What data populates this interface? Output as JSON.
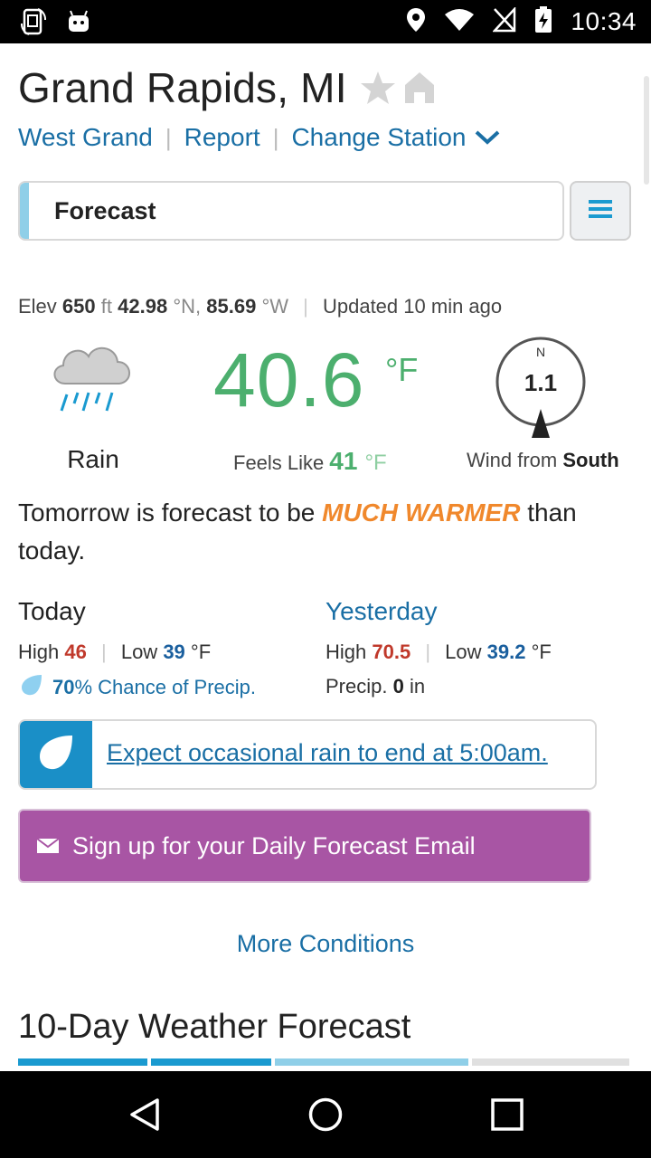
{
  "status_bar": {
    "time": "10:34",
    "icons": [
      "screen-rotate-icon",
      "android-icon",
      "location-icon",
      "wifi-icon",
      "no-sim-icon",
      "battery-charging-icon"
    ]
  },
  "header": {
    "city": "Grand Rapids, MI",
    "station": "West Grand",
    "report": "Report",
    "change_station": "Change Station"
  },
  "tab": {
    "label": "Forecast"
  },
  "meta": {
    "elev_label": "Elev",
    "elev_value": "650",
    "elev_unit": "ft",
    "lat_value": "42.98",
    "lat_unit": "°N,",
    "lon_value": "85.69",
    "lon_unit": "°W",
    "updated_label": "Updated",
    "updated_value": "10 min ago"
  },
  "current": {
    "condition": "Rain",
    "temperature": "40.6",
    "temp_unit": "°F",
    "feels_like_label": "Feels Like",
    "feels_like_value": "41",
    "feels_like_unit": "°F",
    "wind_direction_letter": "N",
    "wind_speed": "1.1",
    "wind_label": "Wind from",
    "wind_from": "South"
  },
  "summary": {
    "before": "Tomorrow is forecast to be",
    "highlight": "MUCH WARMER",
    "after": "than today."
  },
  "today": {
    "title": "Today",
    "high_label": "High",
    "high": "46",
    "low_label": "Low",
    "low": "39",
    "unit": "°F",
    "precip_pct": "70",
    "precip_text": "% Chance of Precip."
  },
  "yesterday": {
    "title": "Yesterday",
    "high_label": "High",
    "high": "70.5",
    "low_label": "Low",
    "low": "39.2",
    "unit": "°F",
    "precip_label": "Precip.",
    "precip_value": "0",
    "precip_unit": "in"
  },
  "alert": {
    "text": "Expect occasional rain to end at 5:00am."
  },
  "email_button": {
    "label": "Sign up for your Daily Forecast Email"
  },
  "more_conditions": "More Conditions",
  "ten_day_title": "10-Day Weather Forecast",
  "colors": {
    "accent_blue": "#1a6fa5",
    "temp_green": "#4caf6e",
    "warm_orange": "#f0882c",
    "high_red": "#c0392b",
    "email_purple": "#a855a4"
  }
}
